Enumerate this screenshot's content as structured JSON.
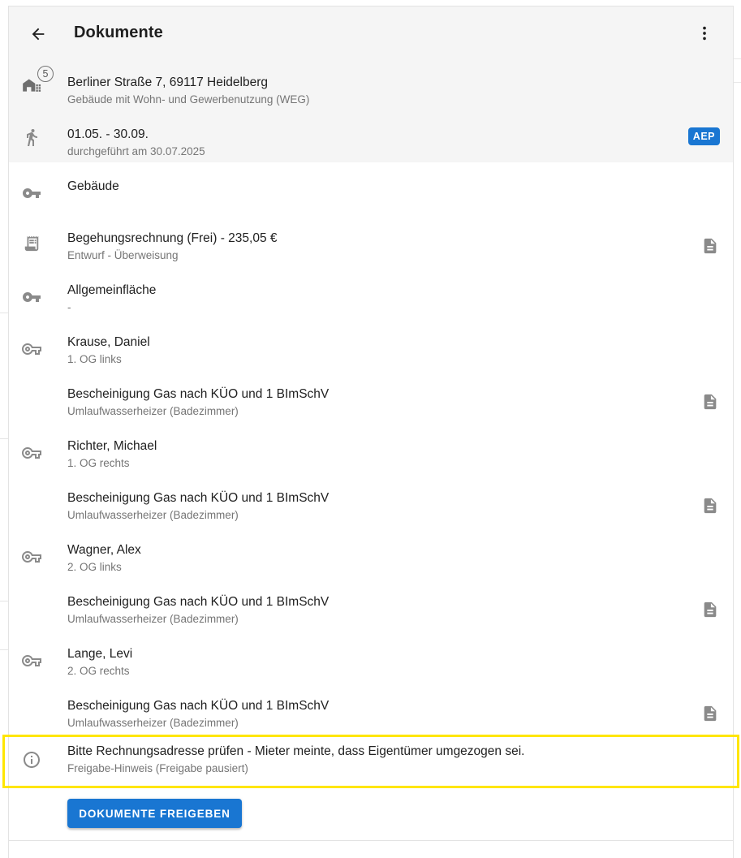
{
  "header": {
    "title": "Dokumente",
    "back_icon": "arrow-left-icon",
    "more_icon": "more-vertical-icon"
  },
  "property": {
    "address": "Berliner Straße 7, 69117 Heidelberg",
    "type": "Gebäude mit Wohn- und Gewerbenutzung (WEG)",
    "unit_count": "5",
    "icon": "home-group-icon"
  },
  "visit": {
    "period": "01.05. - 30.09.",
    "done": "durchgeführt am 30.07.2025",
    "badge": "AEP",
    "icon": "walking-person-icon"
  },
  "items": [
    {
      "icon": "key-icon",
      "title": "Gebäude",
      "subtitle": "",
      "doc": false
    },
    {
      "icon": "receipt-icon",
      "title": "Begehungsrechnung (Frei) - 235,05 €",
      "subtitle": "Entwurf - Überweisung",
      "doc": true
    },
    {
      "icon": "key-icon",
      "title": "Allgemeinfläche",
      "subtitle": "-",
      "doc": false
    },
    {
      "icon": "key-outline-icon",
      "title": "Krause, Daniel",
      "subtitle": "1. OG links",
      "doc": false
    },
    {
      "icon": "",
      "title": "Bescheinigung Gas nach KÜO und 1 BImSchV",
      "subtitle": "Umlaufwasserheizer (Badezimmer)",
      "doc": true
    },
    {
      "icon": "key-outline-icon",
      "title": "Richter, Michael",
      "subtitle": "1. OG rechts",
      "doc": false
    },
    {
      "icon": "",
      "title": "Bescheinigung Gas nach KÜO und 1 BImSchV",
      "subtitle": "Umlaufwasserheizer (Badezimmer)",
      "doc": true
    },
    {
      "icon": "key-outline-icon",
      "title": "Wagner, Alex",
      "subtitle": "2. OG links",
      "doc": false
    },
    {
      "icon": "",
      "title": "Bescheinigung Gas nach KÜO und 1 BImSchV",
      "subtitle": "Umlaufwasserheizer (Badezimmer)",
      "doc": true
    },
    {
      "icon": "key-outline-icon",
      "title": "Lange, Levi",
      "subtitle": "2. OG rechts",
      "doc": false
    },
    {
      "icon": "",
      "title": "Bescheinigung Gas nach KÜO und 1 BImSchV",
      "subtitle": "Umlaufwasserheizer (Badezimmer)",
      "doc": true
    }
  ],
  "notice": {
    "icon": "info-outline-icon",
    "text": "Bitte Rechnungsadresse prüfen - Mieter meinte, dass Eigentümer umgezogen sei.",
    "sub": "Freigabe-Hinweis (Freigabe pausiert)"
  },
  "actions": {
    "release_label": "DOKUMENTE FREIGEBEN"
  },
  "colors": {
    "accent": "#1976d2",
    "highlight": "#ffe600",
    "icon_gray": "#8a8a8a"
  }
}
